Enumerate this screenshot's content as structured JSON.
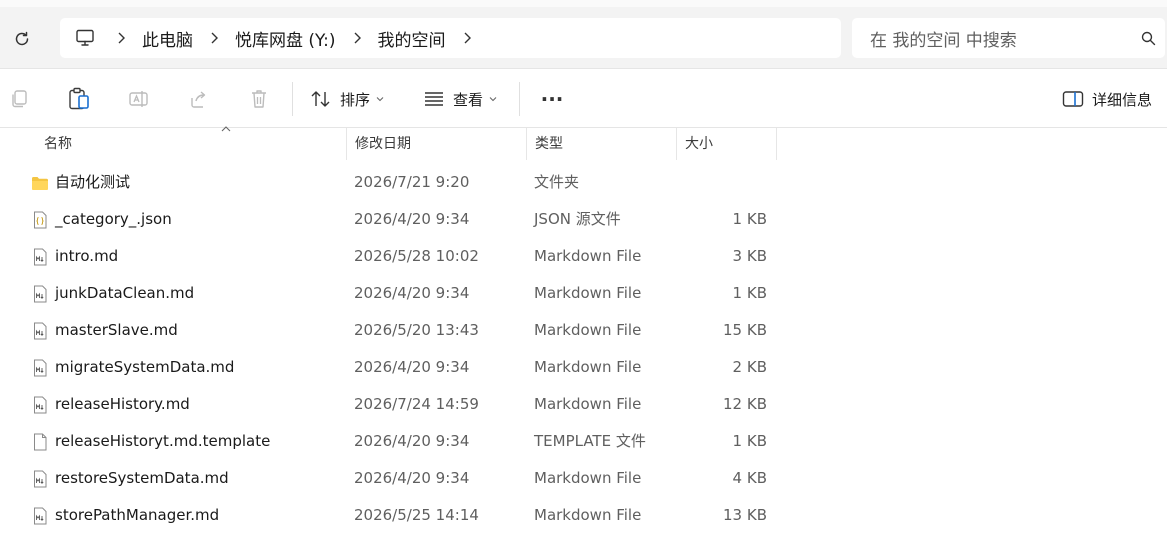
{
  "address": {
    "crumbs": [
      "此电脑",
      "悦库网盘 (Y:)",
      "我的空间"
    ]
  },
  "search": {
    "placeholder": "在 我的空间 中搜索"
  },
  "toolbar": {
    "sort_label": "排序",
    "view_label": "查看",
    "more_label": "···",
    "details_label": "详细信息"
  },
  "columns": {
    "name": "名称",
    "date": "修改日期",
    "type": "类型",
    "size": "大小"
  },
  "files": [
    {
      "name": "自动化测试",
      "date": "2026/7/21 9:20",
      "type": "文件夹",
      "size": "",
      "icon": "folder-icon"
    },
    {
      "name": "_category_.json",
      "date": "2026/4/20 9:34",
      "type": "JSON 源文件",
      "size": "1 KB",
      "icon": "json-file-icon"
    },
    {
      "name": "intro.md",
      "date": "2026/5/28 10:02",
      "type": "Markdown File",
      "size": "3 KB",
      "icon": "markdown-file-icon"
    },
    {
      "name": "junkDataClean.md",
      "date": "2026/4/20 9:34",
      "type": "Markdown File",
      "size": "1 KB",
      "icon": "markdown-file-icon"
    },
    {
      "name": "masterSlave.md",
      "date": "2026/5/20 13:43",
      "type": "Markdown File",
      "size": "15 KB",
      "icon": "markdown-file-icon"
    },
    {
      "name": "migrateSystemData.md",
      "date": "2026/4/20 9:34",
      "type": "Markdown File",
      "size": "2 KB",
      "icon": "markdown-file-icon"
    },
    {
      "name": "releaseHistory.md",
      "date": "2026/7/24 14:59",
      "type": "Markdown File",
      "size": "12 KB",
      "icon": "markdown-file-icon"
    },
    {
      "name": "releaseHistoryt.md.template",
      "date": "2026/4/20 9:34",
      "type": "TEMPLATE 文件",
      "size": "1 KB",
      "icon": "generic-file-icon"
    },
    {
      "name": "restoreSystemData.md",
      "date": "2026/4/20 9:34",
      "type": "Markdown File",
      "size": "4 KB",
      "icon": "markdown-file-icon"
    },
    {
      "name": "storePathManager.md",
      "date": "2026/5/25 14:14",
      "type": "Markdown File",
      "size": "13 KB",
      "icon": "markdown-file-icon"
    }
  ],
  "colors": {
    "folder": "#f4c542",
    "accent": "#1a6fd1",
    "disabled_icon": "#bcbcbc"
  }
}
